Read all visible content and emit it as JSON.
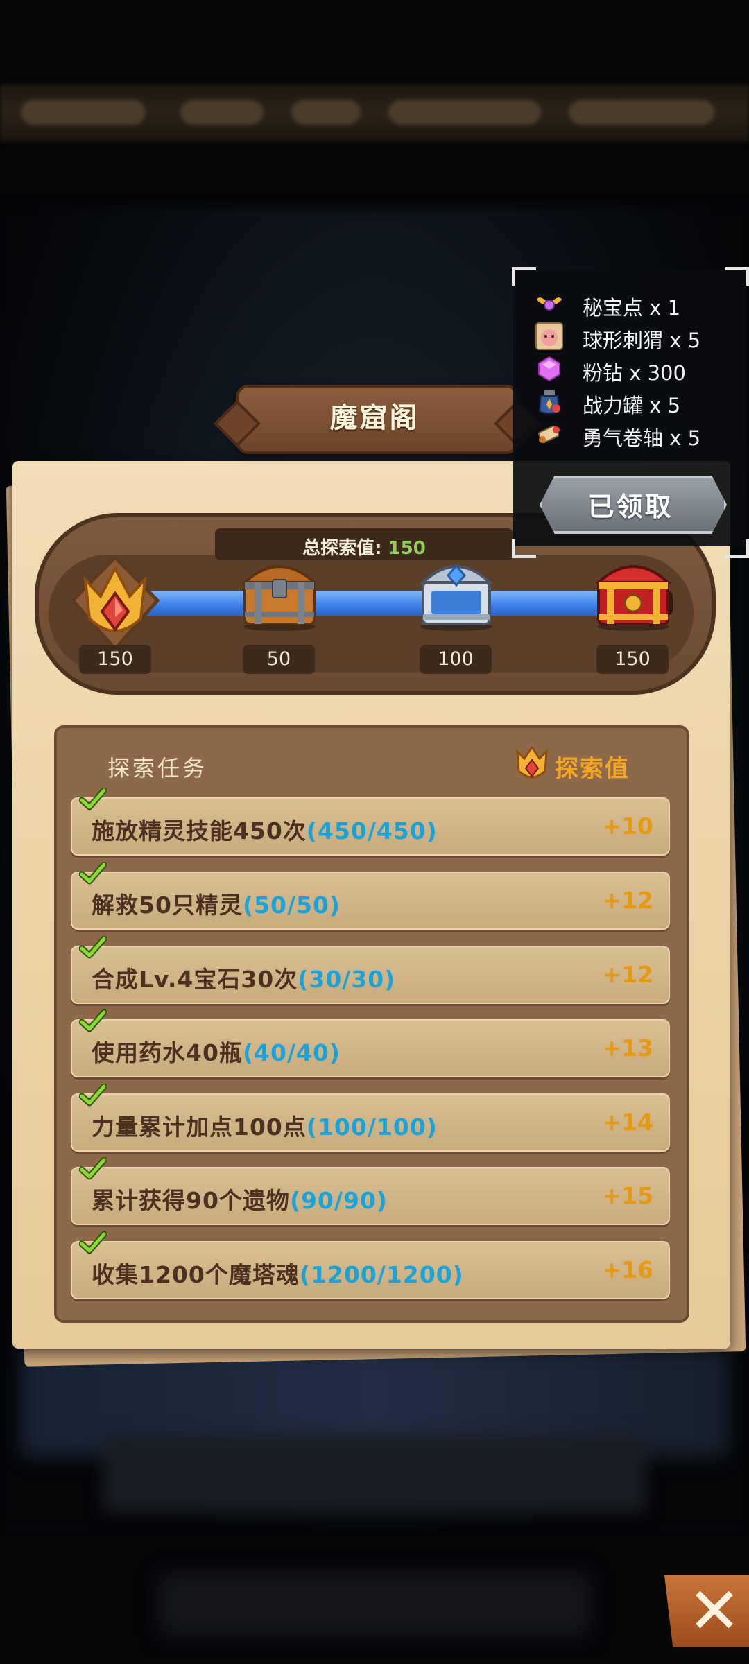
{
  "title": "魔窟阁",
  "total_explore": {
    "label": "总探索值:",
    "value": "150"
  },
  "progress": {
    "current": 150,
    "max": 150,
    "fill_fraction": 0.98
  },
  "milestones": [
    {
      "value": "150",
      "type": "medal",
      "state": "current"
    },
    {
      "value": "50",
      "type": "chest-wood"
    },
    {
      "value": "100",
      "type": "chest-silver"
    },
    {
      "value": "150",
      "type": "chest-red"
    }
  ],
  "task_panel": {
    "header_label": "探索任务",
    "value_label": "探索值",
    "tasks": [
      {
        "name": "施放精灵技能450次",
        "progress": "(450/450)",
        "reward": "+10",
        "done": true
      },
      {
        "name": "解救50只精灵",
        "progress": "(50/50)",
        "reward": "+12",
        "done": true
      },
      {
        "name": "合成Lv.4宝石30次",
        "progress": "(30/30)",
        "reward": "+12",
        "done": true
      },
      {
        "name": "使用药水40瓶",
        "progress": "(40/40)",
        "reward": "+13",
        "done": true
      },
      {
        "name": "力量累计加点100点",
        "progress": "(100/100)",
        "reward": "+14",
        "done": true
      },
      {
        "name": "累计获得90个遗物",
        "progress": "(90/90)",
        "reward": "+15",
        "done": true
      },
      {
        "name": "收集1200个魔塔魂",
        "progress": "(1200/1200)",
        "reward": "+16",
        "done": true
      }
    ]
  },
  "reward_popup": {
    "items": [
      {
        "icon": "wings-icon",
        "text": "秘宝点 x 1"
      },
      {
        "icon": "hedgehog-icon",
        "text": "球形刺猬 x 5"
      },
      {
        "icon": "pink-diamond-icon",
        "text": "粉钻 x 300"
      },
      {
        "icon": "power-jar-icon",
        "text": "战力罐 x 5"
      },
      {
        "icon": "scroll-icon",
        "text": "勇气卷轴 x 5"
      }
    ],
    "button_label": "已领取"
  },
  "colors": {
    "progress_value": "#8fcf5a",
    "task_progress": "#1aa3d8",
    "reward": "#e69a14",
    "value_label": "#f5a623"
  }
}
